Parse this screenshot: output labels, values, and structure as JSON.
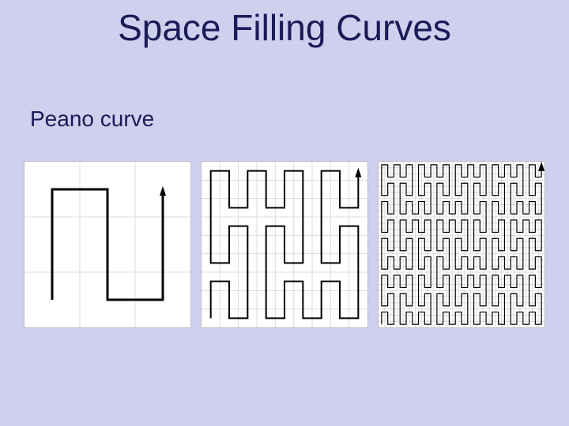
{
  "title": "Space Filling Curves",
  "subtitle": "Peano curve",
  "colors": {
    "background": "#cfd0ed",
    "text": "#1a1b57",
    "panel_bg": "#ffffff",
    "grid": "#dcdcdc",
    "curve": "#000000"
  },
  "panels": [
    {
      "name": "peano-iteration-1",
      "grid_divisions": 3
    },
    {
      "name": "peano-iteration-2",
      "grid_divisions": 9
    },
    {
      "name": "peano-iteration-3",
      "grid_divisions": 27
    }
  ]
}
